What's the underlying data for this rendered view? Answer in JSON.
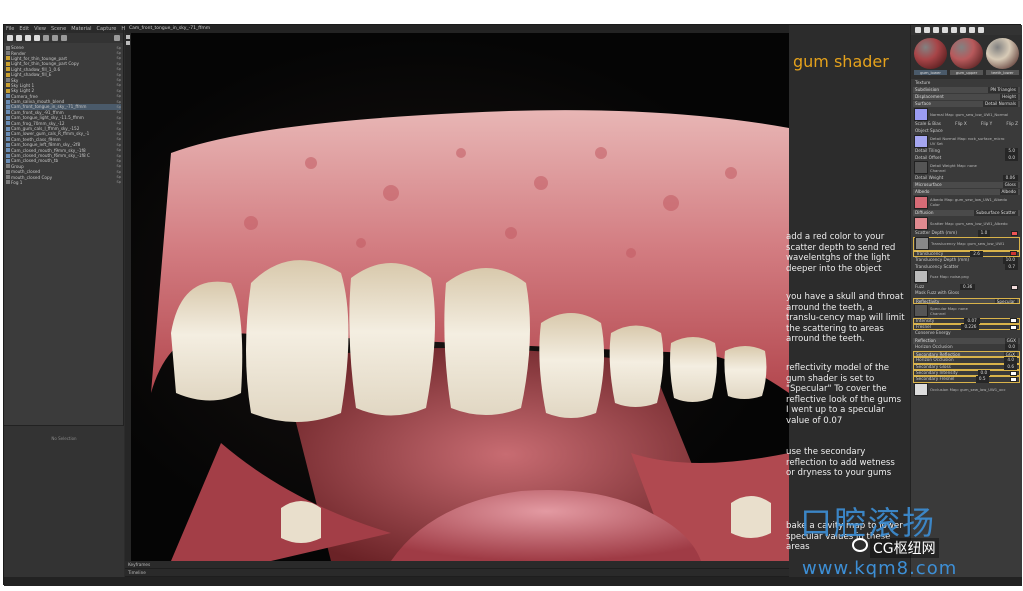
{
  "menu": [
    "File",
    "Edit",
    "View",
    "Scene",
    "Material",
    "Capture",
    "Help"
  ],
  "viewport_tab": "Cam_front_tongue_in_sky_-71_ffmm",
  "scene_tree": [
    {
      "label": "Scene",
      "icon": "folder",
      "flags": "Sp"
    },
    {
      "label": "Render",
      "icon": "render",
      "flags": "Sp"
    },
    {
      "label": "Light_for_thin_tounge_part",
      "icon": "light",
      "flags": "Sp"
    },
    {
      "label": "Light_for_thin_tounge_part Copy",
      "icon": "light",
      "flags": "Sp"
    },
    {
      "label": "Light_shadow_fill_1_0.6",
      "icon": "light",
      "flags": "Sp"
    },
    {
      "label": "Light_shadow_fill_E",
      "icon": "light",
      "flags": "Sp"
    },
    {
      "label": "Sky",
      "icon": "sky",
      "flags": "Sp"
    },
    {
      "label": "Sky Light 1",
      "icon": "light",
      "flags": "Sp"
    },
    {
      "label": "Sky Light 2",
      "icon": "light",
      "flags": "Sp"
    },
    {
      "label": "Camera_free",
      "icon": "camera",
      "flags": "Sp"
    },
    {
      "label": "Cam_saliva_mouth_blend",
      "icon": "camera",
      "flags": "Sp"
    },
    {
      "label": "Cam_front_tongue_in_sky_-71_ffmm",
      "icon": "camera",
      "flags": "Sp",
      "selected": true
    },
    {
      "label": "Cam_front_sky_-91_ffmm",
      "icon": "camera",
      "flags": "Sp"
    },
    {
      "label": "Cam_tongue_light_sky_-11.5_ffmm",
      "icon": "camera",
      "flags": "Sp"
    },
    {
      "label": "Cam_frog_70mm_sky_-12",
      "icon": "camera",
      "flags": "Sp"
    },
    {
      "label": "Cam_gum_cals_l_ffmm_sky_-152",
      "icon": "camera",
      "flags": "Sp"
    },
    {
      "label": "Cam_lower_gum_cals_R_ffmm_sky_-1",
      "icon": "camera",
      "flags": "Sp"
    },
    {
      "label": "Cam_teeth_class_f9mm",
      "icon": "camera",
      "flags": "Sp"
    },
    {
      "label": "Cam_tongue_left_f8mm_sky_-2f8",
      "icon": "camera",
      "flags": "Sp"
    },
    {
      "label": "Cam_closed_mouth_f9mm_sky_-1f8",
      "icon": "camera",
      "flags": "Sp"
    },
    {
      "label": "Cam_closed_mouth_f6mm_sky_-1f8 C",
      "icon": "camera",
      "flags": "Sp"
    },
    {
      "label": "Cam_closed_mouth_tb",
      "icon": "camera",
      "flags": "Sp"
    },
    {
      "label": "Group",
      "icon": "folder",
      "flags": "Sp"
    },
    {
      "label": "mouth_closed",
      "icon": "folder",
      "flags": "Sp"
    },
    {
      "label": "mouth_closed Copy",
      "icon": "folder",
      "flags": "Sp"
    },
    {
      "label": "Fog 1",
      "icon": "fog",
      "flags": "Sp"
    }
  ],
  "no_selection": "No Selection",
  "viewport_footer": [
    "Keyframes",
    "Timeline"
  ],
  "title_overlay": "gum shader",
  "notes": [
    "add a red color to your scatter depth to send red wavelentghs of the light deeper into the object",
    "you have a skull and throat arround the teeth, a translu-cency map will limit the scattering to areas arround the teeth.",
    "reflectivity model of the gum shader is set to \"Specular\" To cover the reflective look of the gums I went up to a specular value of 0.07",
    "use the secondary reflection to add wetness or dryness to your gums",
    "bake a cavity map to lower specular values in these areas"
  ],
  "materials": [
    {
      "name": "gum_lower",
      "color": "#a84548",
      "selected": true
    },
    {
      "name": "gum_upper",
      "color": "#b85a5c"
    },
    {
      "name": "teeth_lower",
      "color": "#d8cbb7"
    }
  ],
  "props": {
    "texture": "Texture",
    "subdivision": {
      "label": "Subdivision",
      "value": "PN Triangles"
    },
    "displacement": {
      "label": "Displacement",
      "value": "Height"
    },
    "surface": {
      "label": "Surface",
      "value": "Detail Normals"
    },
    "normal_map": {
      "label": "Normal Map:",
      "file": "gum_sew_low_UW1_Normal"
    },
    "scale_bias": "Scale & Bias",
    "flip_x": "Flip X",
    "flip_y": "Flip Y",
    "flip_z": "Flip Z",
    "object_space": "Object Space",
    "detail_normal_map": {
      "label": "Detail Normal Map:",
      "file": "rock_surface_micro"
    },
    "uv_set": "UV Set",
    "detail_tiling": {
      "label": "Detail Tiling",
      "value": "5.0"
    },
    "detail_offset": {
      "label": "Detail Offset",
      "value": "0.0"
    },
    "detail_weight_map": {
      "label": "Detail Weight Map:",
      "file": "none"
    },
    "channel": "Channel",
    "detail_weight": {
      "label": "Detail Weight",
      "value": "0.06"
    },
    "microsurface": {
      "label": "Microsurface",
      "value": "Gloss"
    },
    "albedo": {
      "label": "Albedo",
      "value": "Albedo"
    },
    "albedo_map": {
      "label": "Albedo Map:",
      "file": "gum_sew_low_UW1_Albedo"
    },
    "color_label": "Color",
    "diffusion": {
      "label": "Diffusion",
      "value": "Subsurface Scatter"
    },
    "scatter_map": {
      "label": "Scatter Map:",
      "file": "gum_sew_low_UW1_Albedo"
    },
    "scatter_depth": {
      "label": "Scatter Depth (mm)",
      "value": "1.0"
    },
    "translucency_map": {
      "label": "Translucency Map:",
      "file": "gum_sew_low_UW1"
    },
    "translucency": {
      "label": "Translucency",
      "value": "2.6"
    },
    "translucency_depth": {
      "label": "Translucency Depth (mm)",
      "value": "10.0"
    },
    "translucency_scatter": {
      "label": "Translucency Scatter",
      "value": "0.7"
    },
    "fuzz_map": {
      "label": "Fuzz Map:",
      "file": "noise.png"
    },
    "fuzz": {
      "label": "Fuzz",
      "value": "0.36"
    },
    "mask_fuzz": "Mask Fuzz with Gloss",
    "reflectivity": {
      "label": "Reflectivity",
      "value": "Specular"
    },
    "specular_map": {
      "label": "Specular Map:",
      "file": "none"
    },
    "intensity": {
      "label": "Intensity",
      "value": "0.07"
    },
    "fresnel": {
      "label": "Fresnel",
      "value": "0.226"
    },
    "conserve_energy": "Conserve Energy",
    "reflection": {
      "label": "Reflection",
      "value": "GGX"
    },
    "horizon_occlusion": {
      "label": "Horizon Occlusion",
      "value": "0.0"
    },
    "secondary_reflection": {
      "label": "Secondary Reflection",
      "value": "GGX"
    },
    "horizon_occlusion2": {
      "label": "Horizon Occlusion",
      "value": "4.0"
    },
    "secondary_gloss": {
      "label": "Secondary Gloss",
      "value": "0.6"
    },
    "secondary_intensity": {
      "label": "Secondary Intensity",
      "value": "0.0"
    },
    "secondary_fresnel": {
      "label": "Secondary Fresnel",
      "value": "0.5"
    },
    "occlusion_map": {
      "label": "Occlusion Map:",
      "file": "gum_sew_low_UW1_occ"
    }
  },
  "watermark": {
    "big": "口腔滚扬",
    "wechat": "CG枢纽网",
    "url": "www.kqm8.com"
  },
  "colors": {
    "accent": "#e5a21c",
    "highlight": "#d9b34a",
    "gum": "#c86a6e",
    "tooth": "#ece4d2"
  }
}
